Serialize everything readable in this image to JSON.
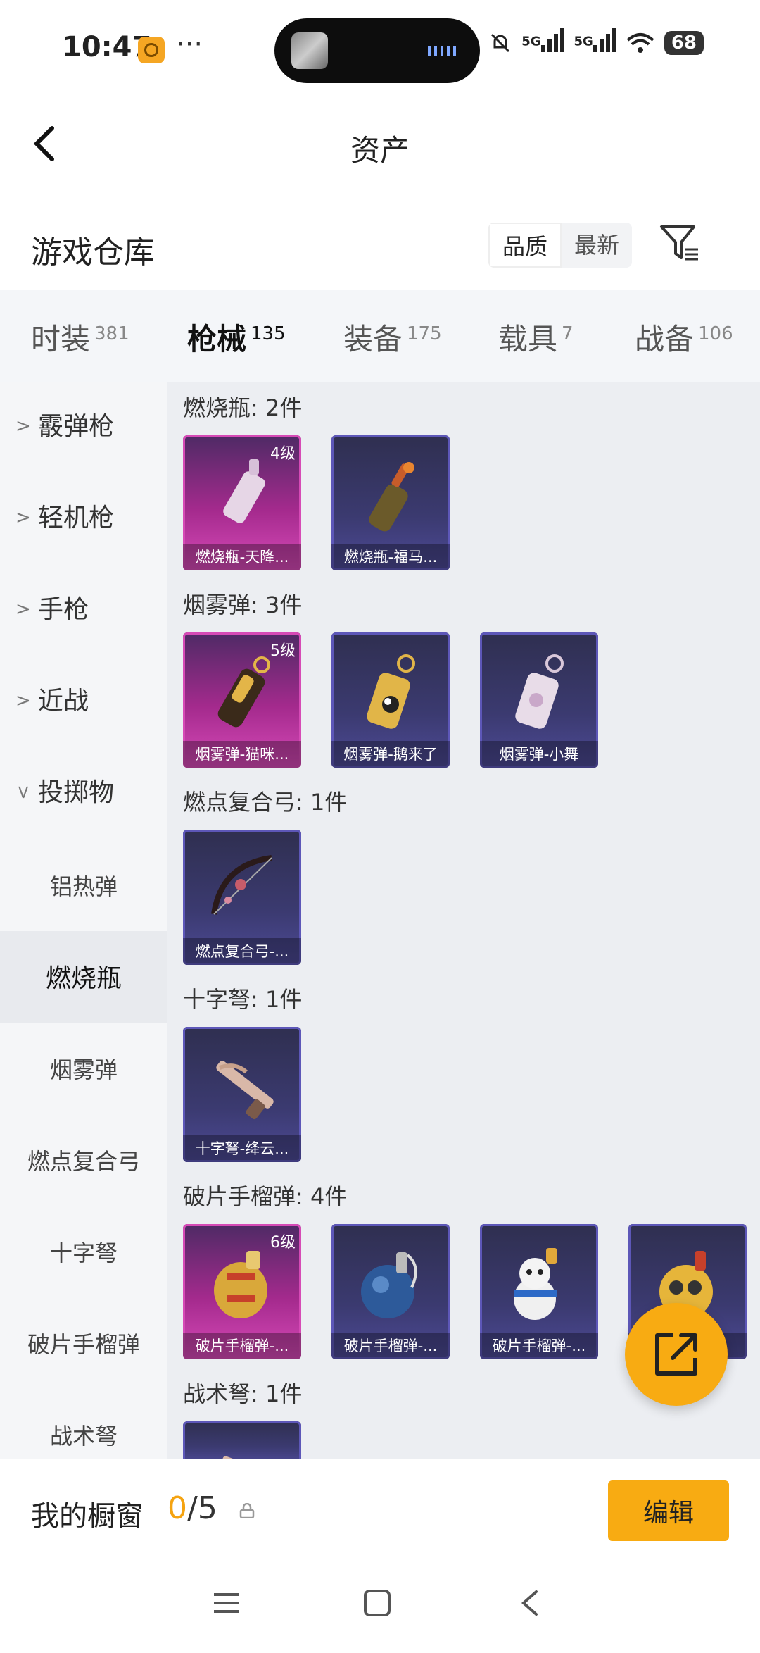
{
  "status": {
    "time": "10:47",
    "more": "···",
    "signal1": "5G",
    "signal2": "5G",
    "battery": "68"
  },
  "header": {
    "title": "资产"
  },
  "warehouse": {
    "title": "游戏仓库",
    "sort_quality": "品质",
    "sort_latest": "最新"
  },
  "tabs": [
    {
      "label": "时装",
      "count": "381"
    },
    {
      "label": "枪械",
      "count": "135"
    },
    {
      "label": "装备",
      "count": "175"
    },
    {
      "label": "载具",
      "count": "7"
    },
    {
      "label": "战备",
      "count": "106"
    }
  ],
  "sidebar": {
    "groups": [
      "霰弹枪",
      "轻机枪",
      "手枪",
      "近战",
      "投掷物"
    ],
    "subs": [
      "铝热弹",
      "燃烧瓶",
      "烟雾弹",
      "燃点复合弓",
      "十字弩",
      "破片手榴弹",
      "战术弩"
    ]
  },
  "sections": [
    {
      "title": "燃烧瓶: 2件",
      "items": [
        {
          "name": "燃烧瓶-天降...",
          "level": "4级",
          "rarity": "pink"
        },
        {
          "name": "燃烧瓶-福马...",
          "level": "",
          "rarity": "blue"
        }
      ]
    },
    {
      "title": "烟雾弹: 3件",
      "items": [
        {
          "name": "烟雾弹-猫咪...",
          "level": "5级",
          "rarity": "pink"
        },
        {
          "name": "烟雾弹-鹅来了",
          "level": "",
          "rarity": "blue"
        },
        {
          "name": "烟雾弹-小舞",
          "level": "",
          "rarity": "blue"
        }
      ]
    },
    {
      "title": "燃点复合弓: 1件",
      "items": [
        {
          "name": "燃点复合弓-...",
          "level": "",
          "rarity": "blue"
        }
      ]
    },
    {
      "title": "十字弩: 1件",
      "items": [
        {
          "name": "十字弩-绛云...",
          "level": "",
          "rarity": "blue"
        }
      ]
    },
    {
      "title": "破片手榴弹: 4件",
      "items": [
        {
          "name": "破片手榴弹-...",
          "level": "6级",
          "rarity": "pink"
        },
        {
          "name": "破片手榴弹-...",
          "level": "",
          "rarity": "blue"
        },
        {
          "name": "破片手榴弹-...",
          "level": "",
          "rarity": "blue"
        },
        {
          "name": "",
          "level": "",
          "rarity": "blue"
        }
      ]
    },
    {
      "title": "战术弩: 1件",
      "items": []
    }
  ],
  "bottom": {
    "label": "我的橱窗",
    "current": "0",
    "total": "/5",
    "edit": "编辑"
  },
  "colors": {
    "accent": "#f8ab12",
    "epic": "#d64ab6",
    "rare": "#5d57b8"
  }
}
